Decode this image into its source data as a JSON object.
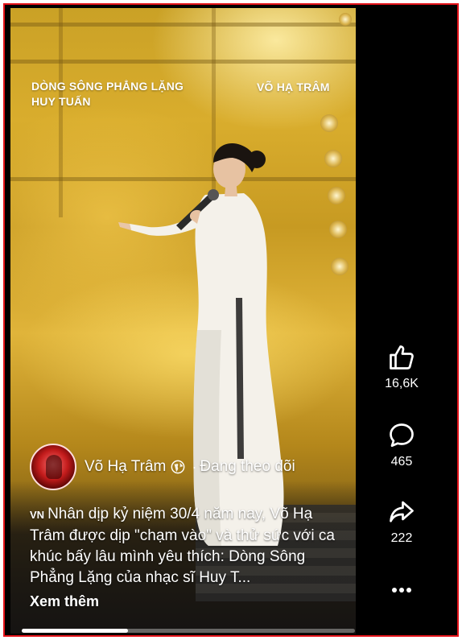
{
  "video": {
    "overlay_song_title_line1": "DÒNG SÔNG PHẲNG LẶNG",
    "overlay_song_title_line2": "HUY TUẤN",
    "overlay_singer_name": "VÕ HẠ TRÂM",
    "progress_fraction": 0.32
  },
  "author": {
    "name": "Võ Hạ Trâm",
    "separator": "·",
    "follow_status": "Đang theo dõi",
    "privacy_icon": "globe-icon"
  },
  "caption": {
    "flag": "VN",
    "text": "Nhân dịp kỷ niệm 30/4 năm nay, Võ Hạ Trâm được dịp \"chạm vào\" và thử sức với ca khúc bấy lâu mình yêu thích: Dòng Sông Phẳng Lặng của nhạc sĩ Huy T...",
    "see_more": "Xem thêm"
  },
  "actions": {
    "like": {
      "icon": "thumbs-up-icon",
      "count": "16,6K"
    },
    "comment": {
      "icon": "comment-bubble-icon",
      "count": "465"
    },
    "share": {
      "icon": "share-arrow-icon",
      "count": "222"
    },
    "more": {
      "icon": "more-dots-icon"
    }
  },
  "colors": {
    "frame_border": "#e5141b",
    "rail_background": "#000000",
    "text": "#ffffff"
  }
}
